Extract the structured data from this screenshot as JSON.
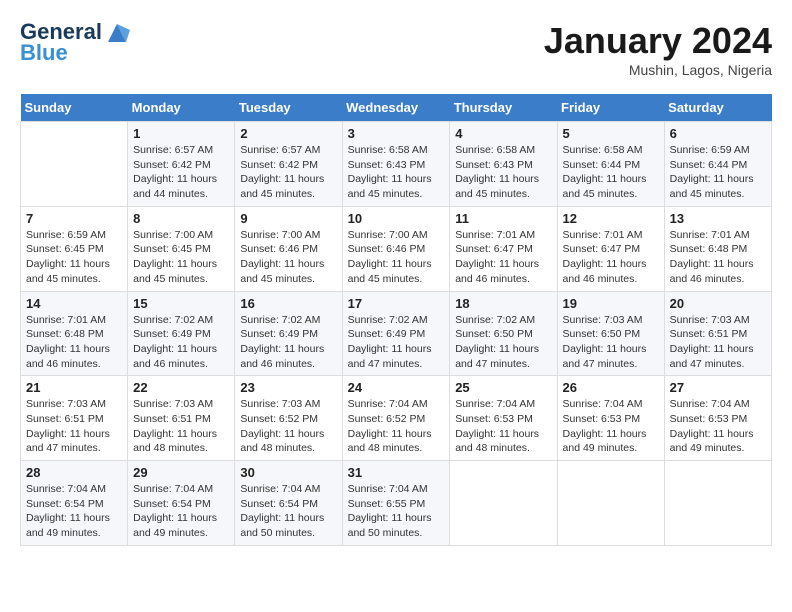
{
  "header": {
    "logo_line1": "General",
    "logo_line2": "Blue",
    "month_title": "January 2024",
    "location": "Mushin, Lagos, Nigeria"
  },
  "weekdays": [
    "Sunday",
    "Monday",
    "Tuesday",
    "Wednesday",
    "Thursday",
    "Friday",
    "Saturday"
  ],
  "weeks": [
    [
      {
        "day": "",
        "sunrise": "",
        "sunset": "",
        "daylight": ""
      },
      {
        "day": "1",
        "sunrise": "Sunrise: 6:57 AM",
        "sunset": "Sunset: 6:42 PM",
        "daylight": "Daylight: 11 hours and 44 minutes."
      },
      {
        "day": "2",
        "sunrise": "Sunrise: 6:57 AM",
        "sunset": "Sunset: 6:42 PM",
        "daylight": "Daylight: 11 hours and 45 minutes."
      },
      {
        "day": "3",
        "sunrise": "Sunrise: 6:58 AM",
        "sunset": "Sunset: 6:43 PM",
        "daylight": "Daylight: 11 hours and 45 minutes."
      },
      {
        "day": "4",
        "sunrise": "Sunrise: 6:58 AM",
        "sunset": "Sunset: 6:43 PM",
        "daylight": "Daylight: 11 hours and 45 minutes."
      },
      {
        "day": "5",
        "sunrise": "Sunrise: 6:58 AM",
        "sunset": "Sunset: 6:44 PM",
        "daylight": "Daylight: 11 hours and 45 minutes."
      },
      {
        "day": "6",
        "sunrise": "Sunrise: 6:59 AM",
        "sunset": "Sunset: 6:44 PM",
        "daylight": "Daylight: 11 hours and 45 minutes."
      }
    ],
    [
      {
        "day": "7",
        "sunrise": "Sunrise: 6:59 AM",
        "sunset": "Sunset: 6:45 PM",
        "daylight": "Daylight: 11 hours and 45 minutes."
      },
      {
        "day": "8",
        "sunrise": "Sunrise: 7:00 AM",
        "sunset": "Sunset: 6:45 PM",
        "daylight": "Daylight: 11 hours and 45 minutes."
      },
      {
        "day": "9",
        "sunrise": "Sunrise: 7:00 AM",
        "sunset": "Sunset: 6:46 PM",
        "daylight": "Daylight: 11 hours and 45 minutes."
      },
      {
        "day": "10",
        "sunrise": "Sunrise: 7:00 AM",
        "sunset": "Sunset: 6:46 PM",
        "daylight": "Daylight: 11 hours and 45 minutes."
      },
      {
        "day": "11",
        "sunrise": "Sunrise: 7:01 AM",
        "sunset": "Sunset: 6:47 PM",
        "daylight": "Daylight: 11 hours and 46 minutes."
      },
      {
        "day": "12",
        "sunrise": "Sunrise: 7:01 AM",
        "sunset": "Sunset: 6:47 PM",
        "daylight": "Daylight: 11 hours and 46 minutes."
      },
      {
        "day": "13",
        "sunrise": "Sunrise: 7:01 AM",
        "sunset": "Sunset: 6:48 PM",
        "daylight": "Daylight: 11 hours and 46 minutes."
      }
    ],
    [
      {
        "day": "14",
        "sunrise": "Sunrise: 7:01 AM",
        "sunset": "Sunset: 6:48 PM",
        "daylight": "Daylight: 11 hours and 46 minutes."
      },
      {
        "day": "15",
        "sunrise": "Sunrise: 7:02 AM",
        "sunset": "Sunset: 6:49 PM",
        "daylight": "Daylight: 11 hours and 46 minutes."
      },
      {
        "day": "16",
        "sunrise": "Sunrise: 7:02 AM",
        "sunset": "Sunset: 6:49 PM",
        "daylight": "Daylight: 11 hours and 46 minutes."
      },
      {
        "day": "17",
        "sunrise": "Sunrise: 7:02 AM",
        "sunset": "Sunset: 6:49 PM",
        "daylight": "Daylight: 11 hours and 47 minutes."
      },
      {
        "day": "18",
        "sunrise": "Sunrise: 7:02 AM",
        "sunset": "Sunset: 6:50 PM",
        "daylight": "Daylight: 11 hours and 47 minutes."
      },
      {
        "day": "19",
        "sunrise": "Sunrise: 7:03 AM",
        "sunset": "Sunset: 6:50 PM",
        "daylight": "Daylight: 11 hours and 47 minutes."
      },
      {
        "day": "20",
        "sunrise": "Sunrise: 7:03 AM",
        "sunset": "Sunset: 6:51 PM",
        "daylight": "Daylight: 11 hours and 47 minutes."
      }
    ],
    [
      {
        "day": "21",
        "sunrise": "Sunrise: 7:03 AM",
        "sunset": "Sunset: 6:51 PM",
        "daylight": "Daylight: 11 hours and 47 minutes."
      },
      {
        "day": "22",
        "sunrise": "Sunrise: 7:03 AM",
        "sunset": "Sunset: 6:51 PM",
        "daylight": "Daylight: 11 hours and 48 minutes."
      },
      {
        "day": "23",
        "sunrise": "Sunrise: 7:03 AM",
        "sunset": "Sunset: 6:52 PM",
        "daylight": "Daylight: 11 hours and 48 minutes."
      },
      {
        "day": "24",
        "sunrise": "Sunrise: 7:04 AM",
        "sunset": "Sunset: 6:52 PM",
        "daylight": "Daylight: 11 hours and 48 minutes."
      },
      {
        "day": "25",
        "sunrise": "Sunrise: 7:04 AM",
        "sunset": "Sunset: 6:53 PM",
        "daylight": "Daylight: 11 hours and 48 minutes."
      },
      {
        "day": "26",
        "sunrise": "Sunrise: 7:04 AM",
        "sunset": "Sunset: 6:53 PM",
        "daylight": "Daylight: 11 hours and 49 minutes."
      },
      {
        "day": "27",
        "sunrise": "Sunrise: 7:04 AM",
        "sunset": "Sunset: 6:53 PM",
        "daylight": "Daylight: 11 hours and 49 minutes."
      }
    ],
    [
      {
        "day": "28",
        "sunrise": "Sunrise: 7:04 AM",
        "sunset": "Sunset: 6:54 PM",
        "daylight": "Daylight: 11 hours and 49 minutes."
      },
      {
        "day": "29",
        "sunrise": "Sunrise: 7:04 AM",
        "sunset": "Sunset: 6:54 PM",
        "daylight": "Daylight: 11 hours and 49 minutes."
      },
      {
        "day": "30",
        "sunrise": "Sunrise: 7:04 AM",
        "sunset": "Sunset: 6:54 PM",
        "daylight": "Daylight: 11 hours and 50 minutes."
      },
      {
        "day": "31",
        "sunrise": "Sunrise: 7:04 AM",
        "sunset": "Sunset: 6:55 PM",
        "daylight": "Daylight: 11 hours and 50 minutes."
      },
      {
        "day": "",
        "sunrise": "",
        "sunset": "",
        "daylight": ""
      },
      {
        "day": "",
        "sunrise": "",
        "sunset": "",
        "daylight": ""
      },
      {
        "day": "",
        "sunrise": "",
        "sunset": "",
        "daylight": ""
      }
    ]
  ]
}
